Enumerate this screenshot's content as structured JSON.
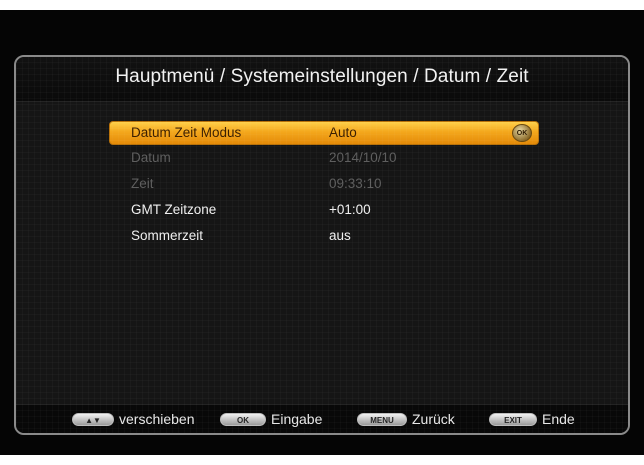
{
  "title": "Hauptmenü / Systemeinstellungen / Datum / Zeit",
  "menu": {
    "items": [
      {
        "label": "Datum Zeit Modus",
        "value": "Auto",
        "state": "selected",
        "ok_key": "OK"
      },
      {
        "label": "Datum",
        "value": "2014/10/10",
        "state": "disabled"
      },
      {
        "label": "Zeit",
        "value": "09:33:10",
        "state": "disabled"
      },
      {
        "label": "GMT Zeitzone",
        "value": "+01:00",
        "state": "normal"
      },
      {
        "label": "Sommerzeit",
        "value": "aus",
        "state": "normal"
      }
    ]
  },
  "footer": {
    "hints": [
      {
        "key": "▲▼",
        "label": "verschieben",
        "icon": "up-down-key-icon"
      },
      {
        "key": "OK",
        "label": "Eingabe",
        "icon": "ok-key-icon"
      },
      {
        "key": "MENU",
        "label": "Zurück",
        "icon": "menu-key-icon"
      },
      {
        "key": "EXIT",
        "label": "Ende",
        "icon": "exit-key-icon"
      }
    ]
  },
  "colors": {
    "selection": "#f4a71c",
    "background": "#151515",
    "text": "#f0f0f0",
    "disabled_text": "#5e5e5e"
  }
}
